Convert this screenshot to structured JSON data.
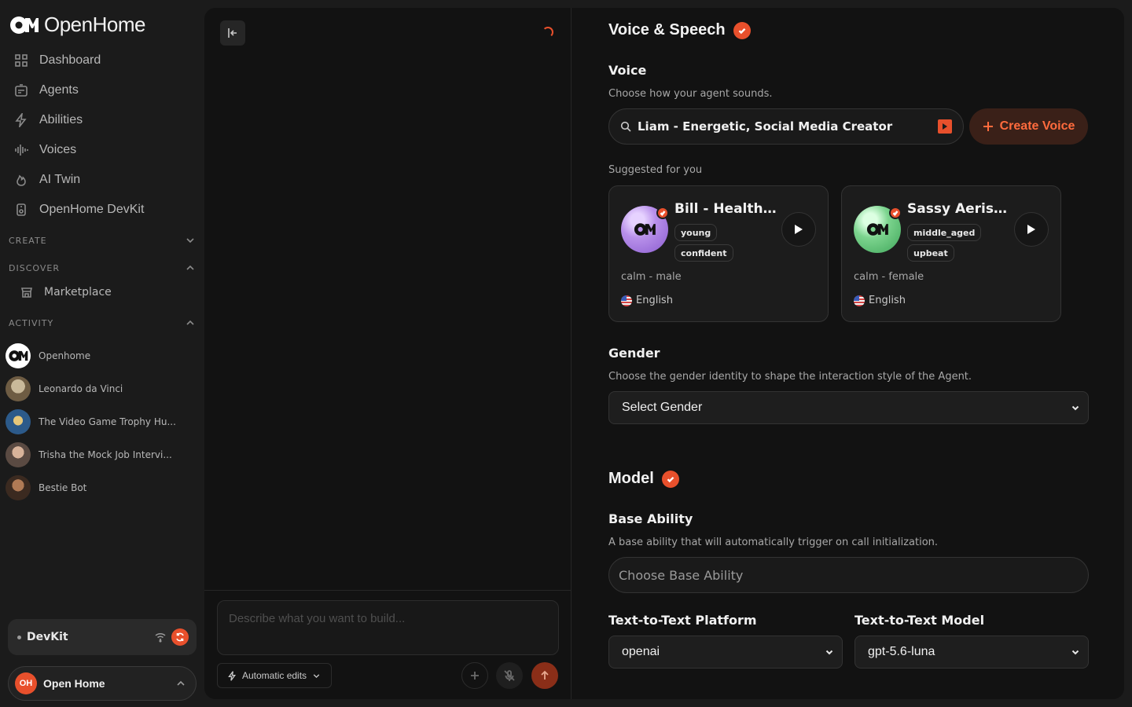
{
  "brand": {
    "name": "OpenHome"
  },
  "nav": [
    {
      "label": "Dashboard",
      "icon": "grid-icon"
    },
    {
      "label": "Agents",
      "icon": "agent-icon"
    },
    {
      "label": "Abilities",
      "icon": "lightning-icon"
    },
    {
      "label": "Voices",
      "icon": "waveform-icon"
    },
    {
      "label": "AI Twin",
      "icon": "flame-icon"
    },
    {
      "label": "OpenHome DevKit",
      "icon": "device-icon"
    }
  ],
  "sections": {
    "create": "CREATE",
    "discover": "DISCOVER",
    "activity": "ACTIVITY"
  },
  "discover": {
    "marketplace": "Marketplace"
  },
  "activity": [
    {
      "label": "Openhome"
    },
    {
      "label": "Leonardo da Vinci"
    },
    {
      "label": "The Video Game Trophy Hu..."
    },
    {
      "label": "Trisha the Mock Job Intervi..."
    },
    {
      "label": "Bestie Bot"
    }
  ],
  "devkit": {
    "label": "DevKit"
  },
  "user": {
    "initials": "OH",
    "name": "Open Home"
  },
  "chat": {
    "placeholder": "Describe what you want to build...",
    "auto_edits": "Automatic edits"
  },
  "voice_section": {
    "title": "Voice & Speech",
    "voice_label": "Voice",
    "voice_desc": "Choose how your agent sounds.",
    "voice_value": "Liam - Energetic, Social Media Creator",
    "create_voice": "Create Voice",
    "suggested": "Suggested for you",
    "cards": [
      {
        "name": "Bill - Health ...",
        "tags": [
          "young",
          "confident"
        ],
        "meta": "calm - male",
        "language": "English",
        "accent": "#b890ea"
      },
      {
        "name": "Sassy Aerisi...",
        "tags": [
          "middle_aged",
          "upbeat"
        ],
        "meta": "calm - female",
        "language": "English",
        "accent": "#7cd48e"
      }
    ],
    "gender_label": "Gender",
    "gender_desc": "Choose the gender identity to shape the interaction style of the Agent.",
    "gender_value": "Select Gender"
  },
  "model_section": {
    "title": "Model",
    "base_label": "Base Ability",
    "base_desc": "A base ability that will automatically trigger on call initialization.",
    "base_placeholder": "Choose Base Ability",
    "platform_label": "Text-to-Text Platform",
    "platform_value": "openai",
    "model_label": "Text-to-Text Model",
    "model_value": "gpt-5.6-luna"
  },
  "colors": {
    "accent": "#e8502c",
    "background": "#121212",
    "sidebar": "#1b1b1b"
  }
}
